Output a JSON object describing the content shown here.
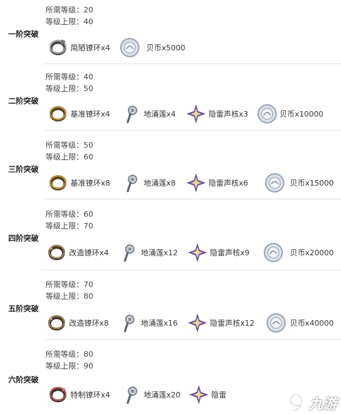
{
  "stages": [
    {
      "name": "一阶突破",
      "req_level": "所需等级：20",
      "level_cap": "等级上限：40",
      "items": [
        {
          "icon": "ring-plain-icon",
          "label": "简陋镣环x4"
        },
        {
          "icon": "shell-coin-icon",
          "label": "贝币x5000"
        }
      ]
    },
    {
      "name": "二阶突破",
      "req_level": "所需等级：40",
      "level_cap": "等级上限：50",
      "items": [
        {
          "icon": "ring-gold-icon",
          "label": "基准镣环x4"
        },
        {
          "icon": "lotus-stone-icon",
          "label": "地涌莲x4"
        },
        {
          "icon": "thunder-core-icon",
          "label": "隐雷声核x3"
        },
        {
          "icon": "shell-coin-icon",
          "label": "贝币x10000"
        }
      ]
    },
    {
      "name": "三阶突破",
      "req_level": "所需等级：50",
      "level_cap": "等级上限：60",
      "items": [
        {
          "icon": "ring-gold-icon",
          "label": "基准镣环x8"
        },
        {
          "icon": "lotus-stone-icon",
          "label": "地涌莲x8"
        },
        {
          "icon": "thunder-core-icon",
          "label": "隐雷声核x6"
        },
        {
          "icon": "shell-coin-icon",
          "label": "贝币x15000"
        }
      ]
    },
    {
      "name": "四阶突破",
      "req_level": "所需等级：60",
      "level_cap": "等级上限：70",
      "items": [
        {
          "icon": "ring-modified-icon",
          "label": "改造镣环x4"
        },
        {
          "icon": "lotus-stone-icon",
          "label": "地涌莲x12"
        },
        {
          "icon": "thunder-core-icon",
          "label": "隐雷声核x9"
        },
        {
          "icon": "shell-coin-icon",
          "label": "贝币x20000"
        }
      ]
    },
    {
      "name": "五阶突破",
      "req_level": "所需等级：70",
      "level_cap": "等级上限：80",
      "items": [
        {
          "icon": "ring-modified-icon",
          "label": "改造镣环x8"
        },
        {
          "icon": "lotus-stone-icon",
          "label": "地涌莲x16"
        },
        {
          "icon": "thunder-core-icon",
          "label": "隐雷声核x12"
        },
        {
          "icon": "shell-coin-icon",
          "label": "贝币x40000"
        }
      ]
    },
    {
      "name": "六阶突破",
      "req_level": "所需等级：80",
      "level_cap": "等级上限：90",
      "items": [
        {
          "icon": "ring-special-icon",
          "label": "特制镣环x4"
        },
        {
          "icon": "lotus-stone-icon",
          "label": "地涌莲x20"
        },
        {
          "icon": "thunder-core-icon",
          "label": "隐雷"
        }
      ]
    }
  ],
  "watermark": {
    "text": "九游",
    "icon": "9game-logo-icon"
  }
}
